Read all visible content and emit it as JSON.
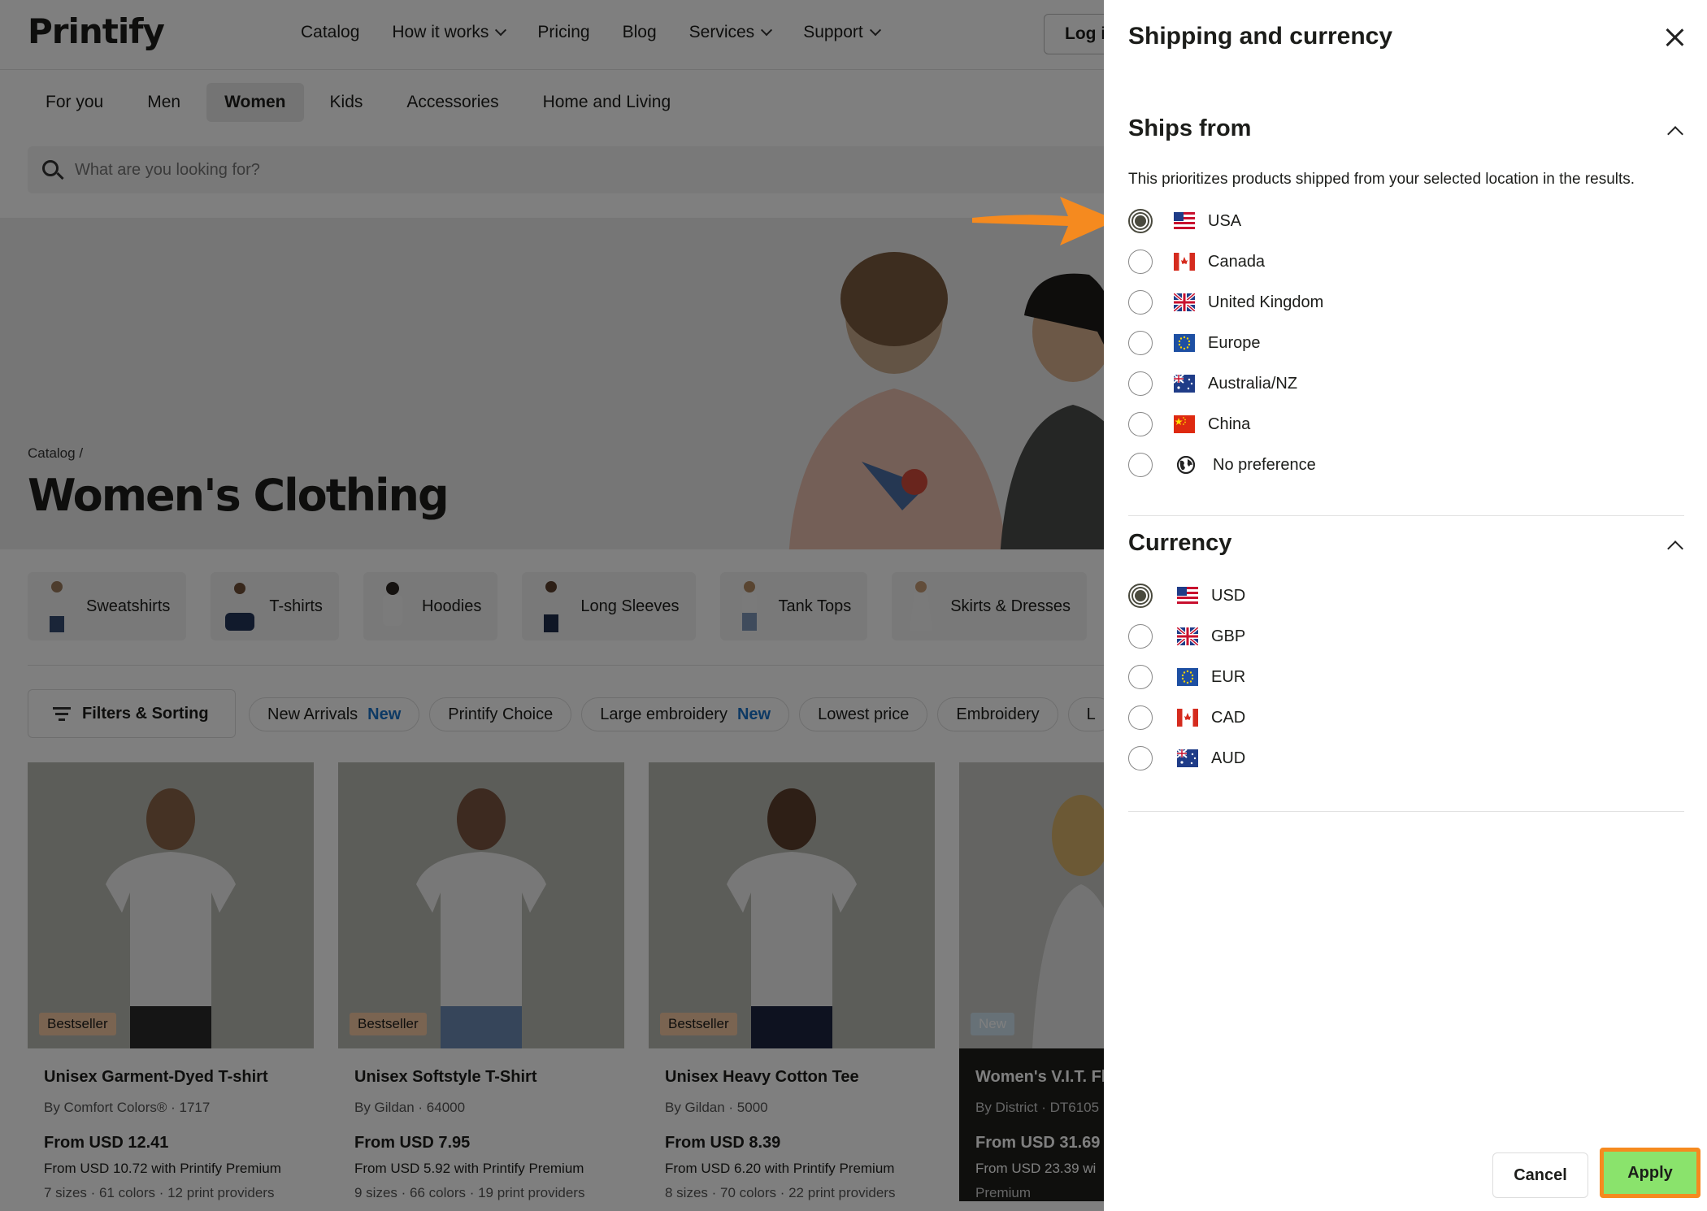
{
  "header": {
    "logo": "Printify",
    "nav": [
      "Catalog",
      "How it works",
      "Pricing",
      "Blog",
      "Services",
      "Support"
    ],
    "login": "Log in"
  },
  "category_tabs": [
    "For you",
    "Men",
    "Women",
    "Kids",
    "Accessories",
    "Home and Living"
  ],
  "active_tab": "Women",
  "search": {
    "placeholder": "What are you looking for?"
  },
  "hero": {
    "breadcrumb": "Catalog /",
    "title": "Women's Clothing"
  },
  "sub_categories": [
    "Sweatshirts",
    "T-shirts",
    "Hoodies",
    "Long Sleeves",
    "Tank Tops",
    "Skirts & Dresses"
  ],
  "filters": {
    "button": "Filters & Sorting",
    "chips": [
      {
        "label": "New Arrivals",
        "tag": "New"
      },
      {
        "label": "Printify Choice",
        "tag": ""
      },
      {
        "label": "Large embroidery",
        "tag": "New"
      },
      {
        "label": "Lowest price",
        "tag": ""
      },
      {
        "label": "Embroidery",
        "tag": ""
      },
      {
        "label": "L",
        "tag": ""
      }
    ]
  },
  "products": [
    {
      "badge": "Bestseller",
      "title": "Unisex Garment-Dyed T-shirt",
      "by": "By Comfort Colors® · 1717",
      "price": "From USD 12.41",
      "premium": "From USD 10.72 with Printify Premium",
      "meta": "7 sizes · 61 colors · 12 print providers"
    },
    {
      "badge": "Bestseller",
      "title": "Unisex Softstyle T-Shirt",
      "by": "By Gildan · 64000",
      "price": "From USD 7.95",
      "premium": "From USD 5.92 with Printify Premium",
      "meta": "9 sizes · 66 colors · 19 print providers"
    },
    {
      "badge": "Bestseller",
      "title": "Unisex Heavy Cotton Tee",
      "by": "By Gildan · 5000",
      "price": "From USD 8.39",
      "premium": "From USD 6.20 with Printify Premium",
      "meta": "8 sizes · 70 colors · 22 print providers"
    },
    {
      "badge": "New",
      "title": "Women's V.I.T. Fl",
      "by": "By District · DT6105",
      "price": "From USD 31.69",
      "premium": "From USD 23.39 wi",
      "meta": "Premium"
    }
  ],
  "panel": {
    "title": "Shipping and currency",
    "ships_from": {
      "title": "Ships from",
      "description": "This prioritizes products shipped from your selected location in the results.",
      "selected": "USA",
      "options": [
        {
          "label": "USA",
          "flag": "us-flag"
        },
        {
          "label": "Canada",
          "flag": "ca-flag"
        },
        {
          "label": "United Kingdom",
          "flag": "uk-flag"
        },
        {
          "label": "Europe",
          "flag": "eu-flag"
        },
        {
          "label": "Australia/NZ",
          "flag": "au-flag"
        },
        {
          "label": "China",
          "flag": "cn-flag"
        },
        {
          "label": "No preference",
          "flag": "globe-icon"
        }
      ]
    },
    "currency": {
      "title": "Currency",
      "selected": "USD",
      "options": [
        {
          "label": "USD",
          "flag": "us-flag"
        },
        {
          "label": "GBP",
          "flag": "uk-flag"
        },
        {
          "label": "EUR",
          "flag": "eu-flag"
        },
        {
          "label": "CAD",
          "flag": "ca-flag"
        },
        {
          "label": "AUD",
          "flag": "au-flag"
        }
      ]
    },
    "cancel": "Cancel",
    "apply": "Apply"
  },
  "colors": {
    "apply_bg": "#8ae36c",
    "highlight": "#f58a1f",
    "selected_radio": "#4a4a3e",
    "link_blue": "#1a73c8"
  }
}
